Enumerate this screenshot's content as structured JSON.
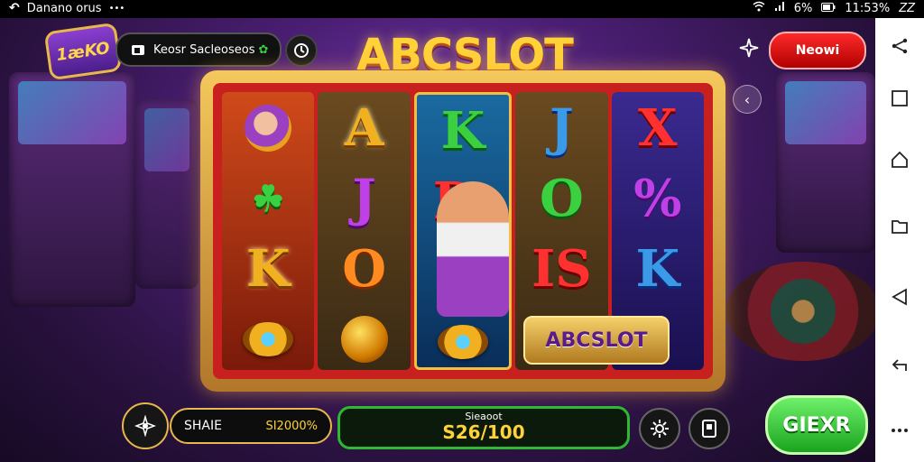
{
  "status_bar": {
    "app_label": "Danano orus",
    "right_text": "6%",
    "time": "11:53%",
    "brand_mark": "ZZ"
  },
  "header": {
    "logo_badge": "1æKO",
    "user_label": "Keosr Sacleoseos",
    "news_button": "Neowi",
    "title_logo": "ABCSLOT"
  },
  "reels": {
    "reel1": [
      "",
      "",
      "K",
      ""
    ],
    "reel2": [
      "A",
      "J",
      "O",
      ""
    ],
    "reel3": [
      "K",
      "D",
      "",
      ""
    ],
    "reel4": [
      "J",
      "O",
      "IS",
      ""
    ],
    "reel5": [
      "X",
      "%",
      "K",
      ""
    ],
    "banner": "ABCSLOT"
  },
  "bottom": {
    "bet_label": "SHAIE",
    "bet_value": "SI2000%",
    "balance_label": "Sieaoot",
    "balance_value": "S26/100",
    "spin_button": "GIEXR"
  },
  "colors": {
    "accent_gold": "#e8b84a",
    "spin_green": "#2fb832",
    "news_red": "#e01010"
  },
  "icons": {
    "status_left": "back-arrow-icon",
    "status_right": [
      "wifi-icon",
      "signal-icon",
      "battery-icon"
    ],
    "nav": [
      "share-icon",
      "square-icon",
      "home-icon",
      "folder-icon",
      "back-triangle-icon",
      "return-icon",
      "more-icon"
    ]
  }
}
